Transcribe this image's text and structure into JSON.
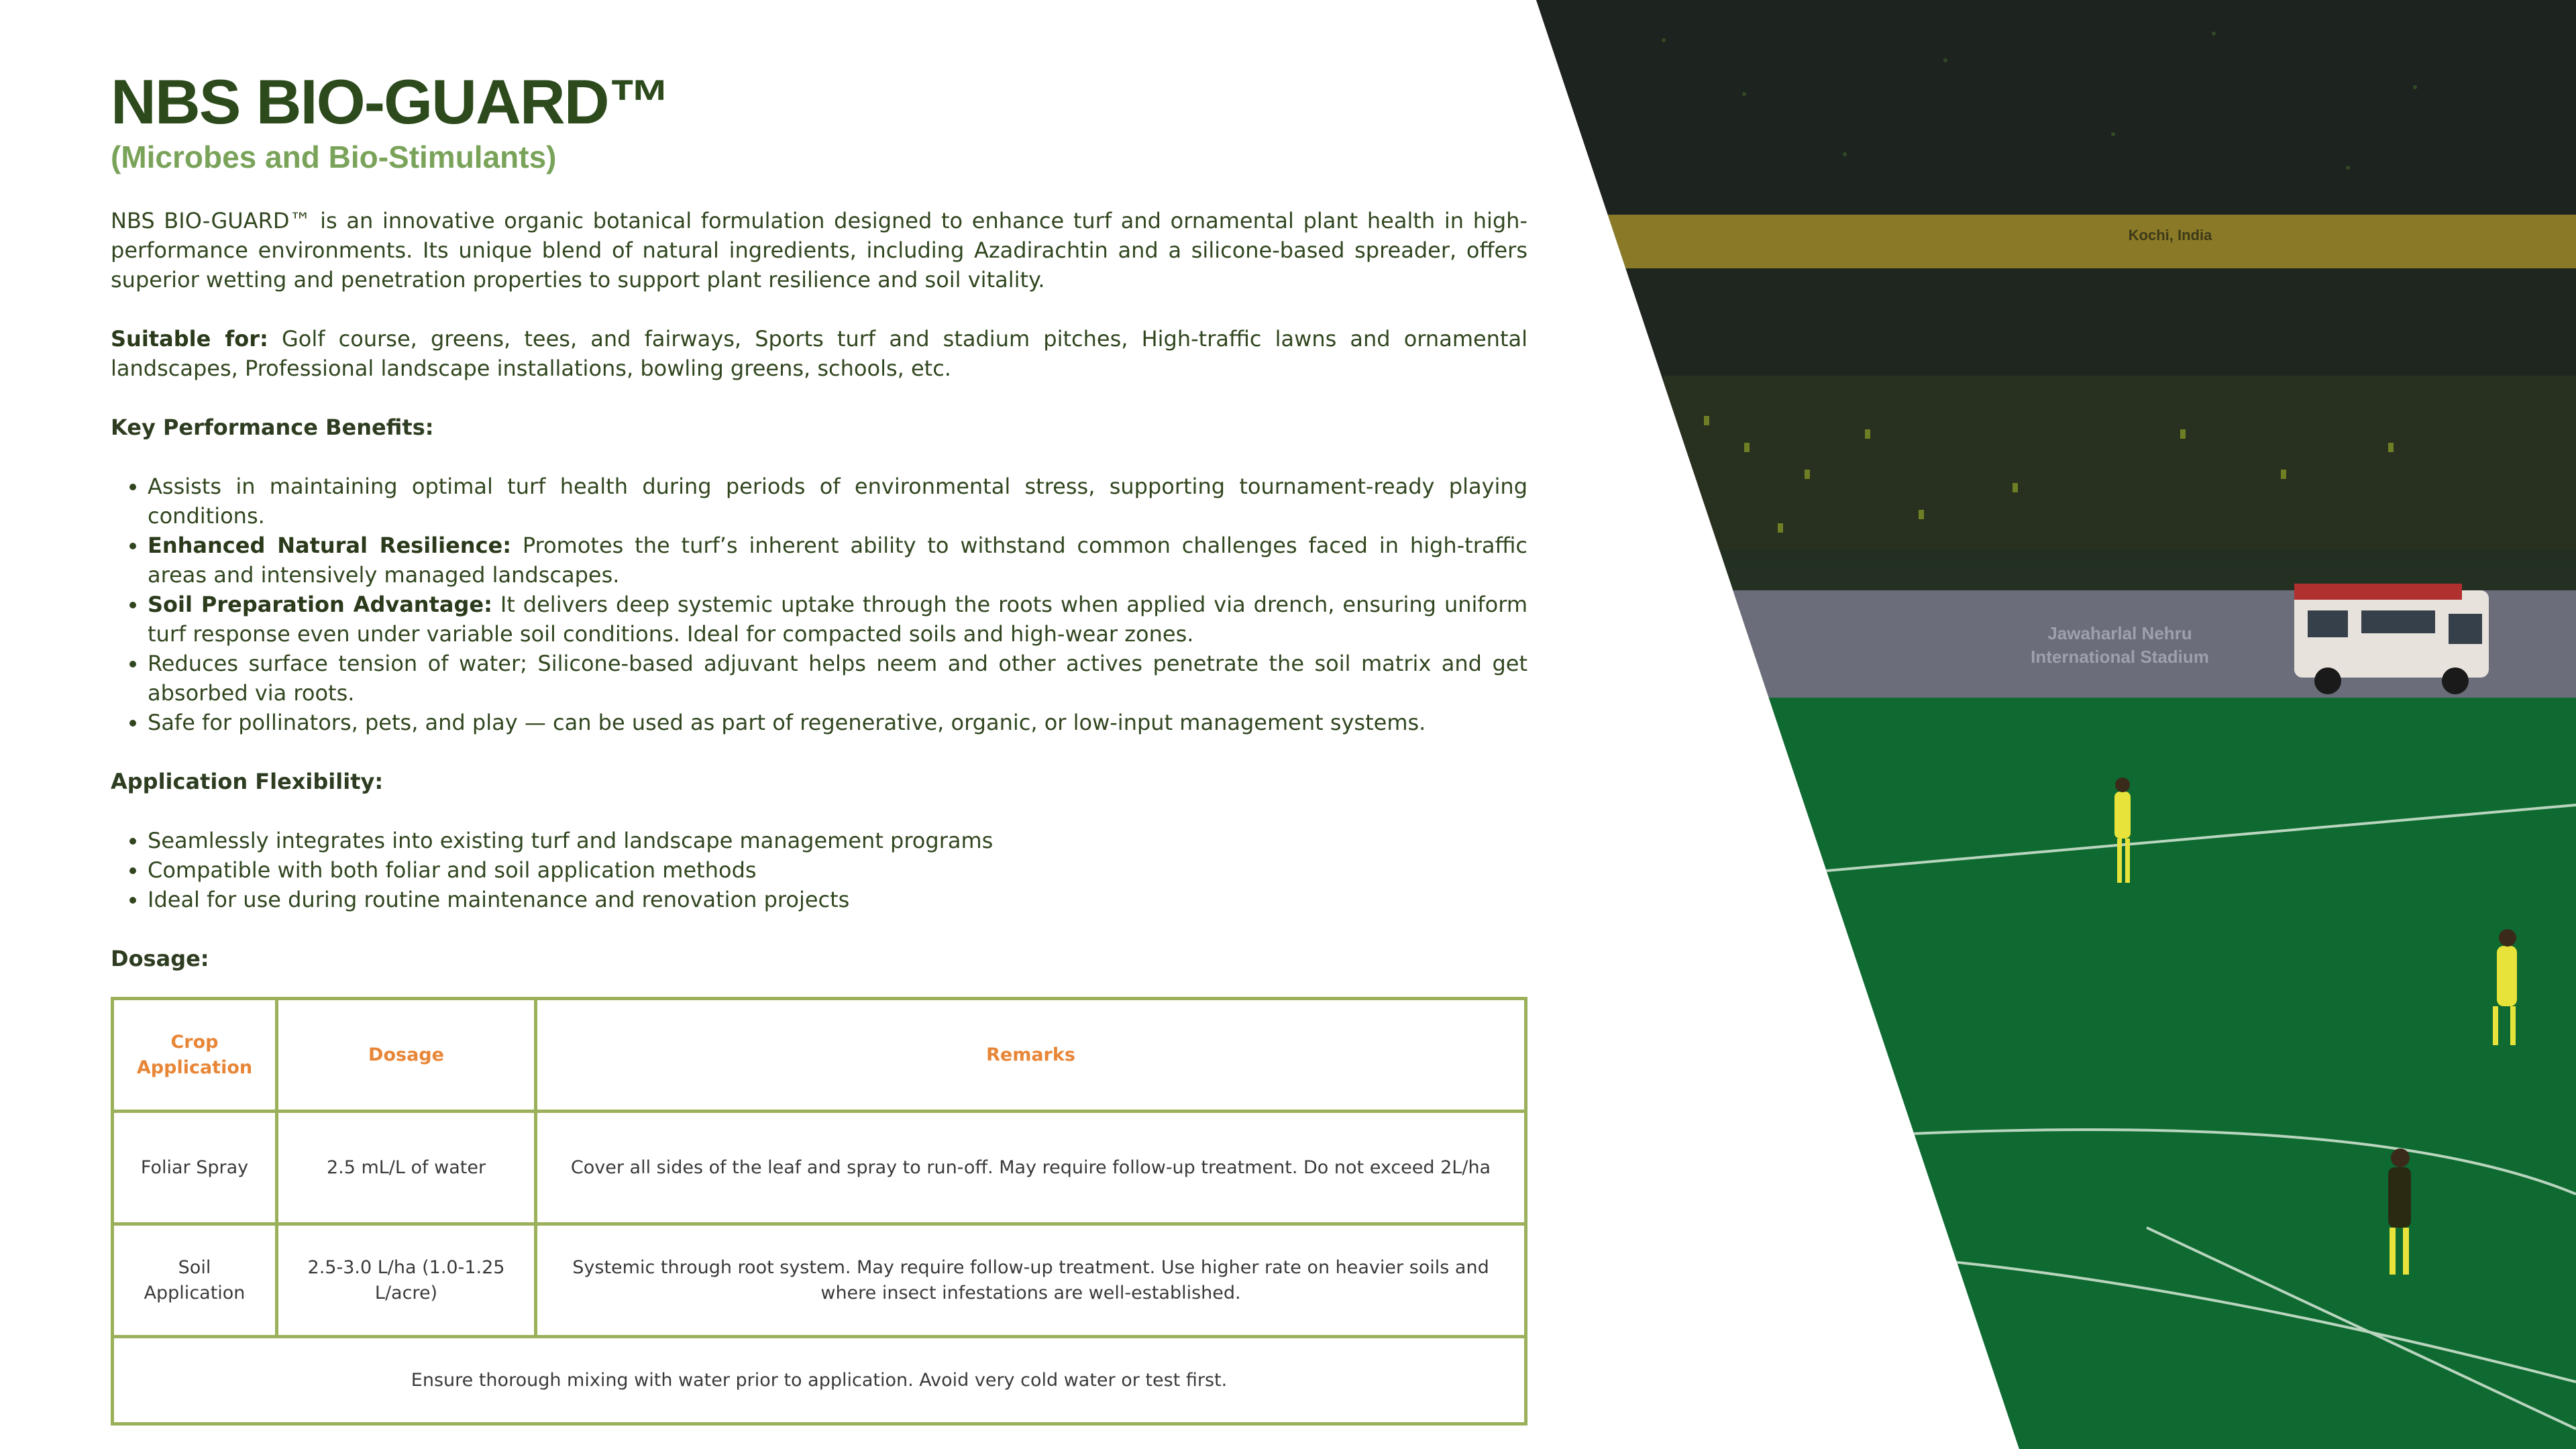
{
  "title": "NBS BIO-GUARD™",
  "subtitle": "(Microbes and Bio-Stimulants)",
  "intro": "NBS BIO-GUARD™ is an innovative organic botanical formulation designed to enhance turf and ornamental plant health in high-performance environments. Its unique blend of natural ingredients, including Azadirachtin and a silicone-based spreader, offers superior wetting and penetration properties to support plant resilience and soil vitality.",
  "suitable": {
    "label": "Suitable for:",
    "text": " Golf course, greens, tees, and fairways, Sports turf and stadium pitches, High-traffic lawns and ornamental landscapes, Professional landscape installations, bowling greens, schools, etc."
  },
  "benefits": {
    "heading": "Key Performance Benefits:",
    "items": [
      {
        "bold": "",
        "text": "Assists in maintaining optimal turf health during periods of environmental stress, supporting tournament-ready playing conditions."
      },
      {
        "bold": "Enhanced Natural Resilience:",
        "text": " Promotes the turf’s inherent ability to withstand common challenges faced in high-traffic areas and intensively managed landscapes."
      },
      {
        "bold": "Soil Preparation Advantage:",
        "text": " It delivers deep systemic uptake through the roots when applied via drench, ensuring uniform turf response even under variable soil conditions. Ideal for compacted soils and high-wear zones."
      },
      {
        "bold": "",
        "text": "Reduces surface tension of water; Silicone-based adjuvant helps neem and other actives penetrate the soil matrix and get absorbed via roots."
      },
      {
        "bold": "",
        "text": "Safe for pollinators, pets, and play — can be used as part of regenerative, organic, or low-input management systems."
      }
    ]
  },
  "flexibility": {
    "heading": "Application Flexibility:",
    "items": [
      "Seamlessly integrates into existing turf and landscape management programs",
      "Compatible with both foliar and soil application methods",
      "Ideal for use during routine maintenance and renovation projects"
    ]
  },
  "dosage_heading": "Dosage:",
  "table": {
    "headers": [
      "Crop Application",
      "Dosage",
      "Remarks"
    ],
    "rows": [
      [
        "Foliar Spray",
        "2.5 mL/L of water",
        "Cover all sides of the leaf and spray to run-off. May require follow-up treatment. Do not exceed 2L/ha"
      ],
      [
        "Soil Application",
        "2.5-3.0 L/ha (1.0-1.25 L/acre)",
        "Systemic through root system. May require follow-up treatment. Use higher rate on heavier soils and where insect infestations are well-established."
      ]
    ],
    "footer": "Ensure thorough mixing with water prior to application. Avoid very cold water or test first."
  },
  "photo": {
    "banner_text": "Kochi, India",
    "stadium_name_1": "Jawaharlal Nehru",
    "stadium_name_2": "International Stadium"
  },
  "colors": {
    "title": "#2c4a1c",
    "subtitle": "#7aa35a",
    "table_border": "#9bb05a",
    "table_header": "#e88637"
  }
}
